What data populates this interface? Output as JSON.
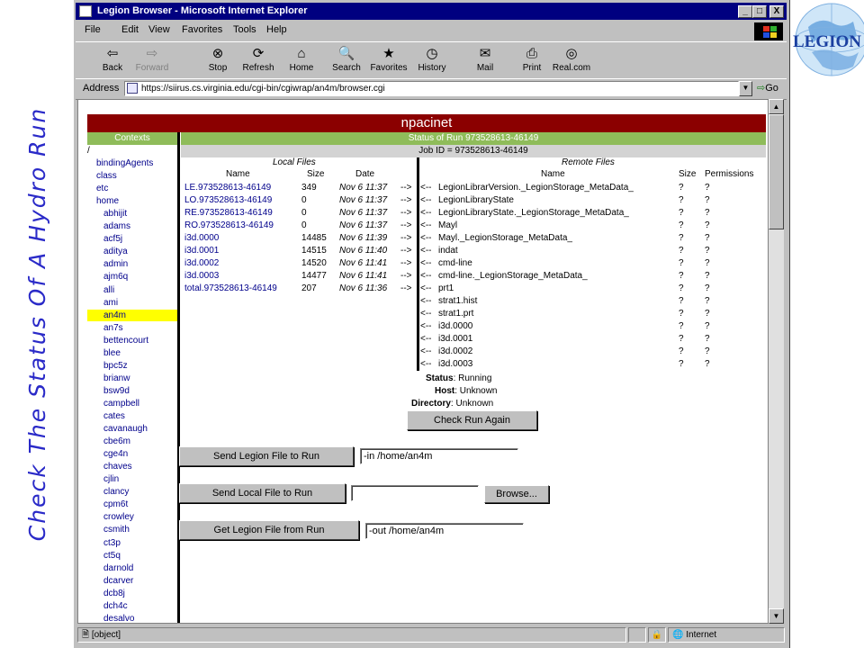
{
  "slide_title": "Check The Status Of A Hydro Run",
  "logo_text": "LEGION",
  "window": {
    "title": "Legion Browser - Microsoft Internet Explorer",
    "controls": [
      "_",
      "□",
      "X"
    ]
  },
  "menu": [
    "File",
    "Edit",
    "View",
    "Favorites",
    "Tools",
    "Help"
  ],
  "toolbar": [
    {
      "label": "Back",
      "icon": "back-arrow-icon",
      "enabled": true
    },
    {
      "label": "Forward",
      "icon": "forward-arrow-icon",
      "enabled": false
    },
    {
      "label": "Stop",
      "icon": "stop-icon",
      "enabled": true
    },
    {
      "label": "Refresh",
      "icon": "refresh-icon",
      "enabled": true
    },
    {
      "label": "Home",
      "icon": "home-icon",
      "enabled": true
    },
    {
      "label": "Search",
      "icon": "search-icon",
      "enabled": true
    },
    {
      "label": "Favorites",
      "icon": "favorites-icon",
      "enabled": true
    },
    {
      "label": "History",
      "icon": "history-icon",
      "enabled": true
    },
    {
      "label": "Mail",
      "icon": "mail-icon",
      "enabled": true
    },
    {
      "label": "Print",
      "icon": "print-icon",
      "enabled": true
    },
    {
      "label": "Real.com",
      "icon": "realcom-icon",
      "enabled": true
    }
  ],
  "address": {
    "label": "Address",
    "url": "https://siirus.cs.virginia.edu/cgi-bin/cgiwrap/an4m/browser.cgi",
    "go_label": "Go"
  },
  "page": {
    "header": "npacinet",
    "contexts_label": "Contexts",
    "status_of_run": "Status of Run 973528613-46149",
    "root_context": "/",
    "job_id": "Job ID = 973528613-46149",
    "contexts": [
      "bindingAgents",
      "class",
      "etc",
      "home",
      "abhijit",
      "adams",
      "acf5j",
      "aditya",
      "admin",
      "ajm6q",
      "alli",
      "ami",
      "an4m",
      "an7s",
      "bettencourt",
      "blee",
      "bpc5z",
      "brianw",
      "bsw9d",
      "campbell",
      "cates",
      "cavanaugh",
      "cbe6m",
      "cge4n",
      "chaves",
      "cjlin",
      "clancy",
      "cpm6t",
      "crowley",
      "csmith",
      "ct3p",
      "ct5q",
      "darnold",
      "dcarver",
      "dcb8j",
      "dch4c",
      "desalvo"
    ],
    "selected_context": "an4m",
    "local_files_label": "Local Files",
    "remote_files_label": "Remote Files",
    "local_columns": [
      "Name",
      "Size",
      "Date"
    ],
    "remote_columns": [
      "Name",
      "Size",
      "Permissions"
    ],
    "local_files": [
      {
        "name": "LE.973528613-46149",
        "size": "349",
        "date": "Nov 6 11:37"
      },
      {
        "name": "LO.973528613-46149",
        "size": "0",
        "date": "Nov 6 11:37"
      },
      {
        "name": "RE.973528613-46149",
        "size": "0",
        "date": "Nov 6 11:37"
      },
      {
        "name": "RO.973528613-46149",
        "size": "0",
        "date": "Nov 6 11:37"
      },
      {
        "name": "i3d.0000",
        "size": "14485",
        "date": "Nov 6 11:39"
      },
      {
        "name": "i3d.0001",
        "size": "14515",
        "date": "Nov 6 11:40"
      },
      {
        "name": "i3d.0002",
        "size": "14520",
        "date": "Nov 6 11:41"
      },
      {
        "name": "i3d.0003",
        "size": "14477",
        "date": "Nov 6 11:41"
      },
      {
        "name": "total.973528613-46149",
        "size": "207",
        "date": "Nov 6 11:36"
      }
    ],
    "arrow_right": "-->",
    "arrow_left": "<--",
    "remote_files": [
      {
        "name": "LegionLibrarVersion._LegionStorage_MetaData_",
        "size": "?",
        "perm": "?"
      },
      {
        "name": "LegionLibraryState",
        "size": "?",
        "perm": "?"
      },
      {
        "name": "LegionLibraryState._LegionStorage_MetaData_",
        "size": "?",
        "perm": "?"
      },
      {
        "name": "Mayl",
        "size": "?",
        "perm": "?"
      },
      {
        "name": "Mayl._LegionStorage_MetaData_",
        "size": "?",
        "perm": "?"
      },
      {
        "name": "indat",
        "size": "?",
        "perm": "?"
      },
      {
        "name": "cmd-line",
        "size": "?",
        "perm": "?"
      },
      {
        "name": "cmd-line._LegionStorage_MetaData_",
        "size": "?",
        "perm": "?"
      },
      {
        "name": "prt1",
        "size": "?",
        "perm": "?"
      },
      {
        "name": "strat1.hist",
        "size": "?",
        "perm": "?"
      },
      {
        "name": "strat1.prt",
        "size": "?",
        "perm": "?"
      },
      {
        "name": "i3d.0000",
        "size": "?",
        "perm": "?"
      },
      {
        "name": "i3d.0001",
        "size": "?",
        "perm": "?"
      },
      {
        "name": "i3d.0002",
        "size": "?",
        "perm": "?"
      },
      {
        "name": "i3d.0003",
        "size": "?",
        "perm": "?"
      }
    ],
    "status": {
      "label": "Status",
      "value": "Running"
    },
    "host": {
      "label": "Host",
      "value": "Unknown"
    },
    "directory": {
      "label": "Directory",
      "value": "Unknown"
    },
    "check_again": "Check Run Again",
    "send_legion_btn": "Send Legion File to Run",
    "send_legion_value": "-in /home/an4m",
    "send_local_btn": "Send Local File to Run",
    "send_local_value": "",
    "browse_btn": "Browse...",
    "get_legion_btn": "Get Legion File from Run",
    "get_legion_value": "-out /home/an4m"
  },
  "statusbar": {
    "left": "[object]",
    "zone": "Internet"
  },
  "colors": {
    "title_blue": "#000080",
    "header_red": "#8b0000",
    "bar_green": "#8fbc5a",
    "link_blue": "#00008b",
    "highlight": "#ffff00",
    "slide_text": "#2a2ac8"
  }
}
